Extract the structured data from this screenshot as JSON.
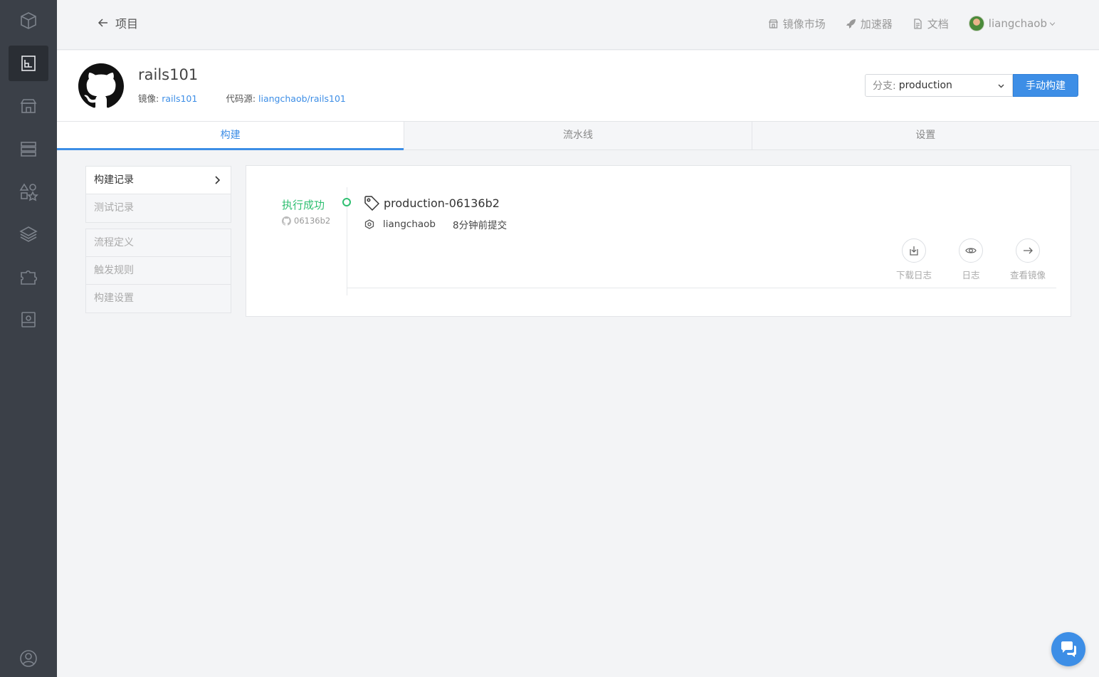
{
  "topbar": {
    "back_label": "项目",
    "nav": {
      "market": "镜像市场",
      "accelerator": "加速器",
      "docs": "文档",
      "user": "liangchaob"
    }
  },
  "project": {
    "name": "rails101",
    "image_label": "镜像:",
    "image_value": "rails101",
    "source_label": "代码源:",
    "source_value": "liangchaob/rails101"
  },
  "branch": {
    "label": "分支:",
    "value": "production"
  },
  "build_button": "手动构建",
  "tabs": [
    "构建",
    "流水线",
    "设置"
  ],
  "side_menu": {
    "group1": [
      "构建记录",
      "测试记录"
    ],
    "group2": [
      "流程定义",
      "触发规则",
      "构建设置"
    ]
  },
  "record": {
    "status": "执行成功",
    "sha": "06136b2",
    "tag": "production-06136b2",
    "author": "liangchaob",
    "time": "8分钟前提交",
    "actions": [
      "下载日志",
      "日志",
      "查看镜像"
    ]
  },
  "colors": {
    "accent": "#3d8ee6",
    "success": "#2fbf71",
    "rail": "#3b4048"
  }
}
